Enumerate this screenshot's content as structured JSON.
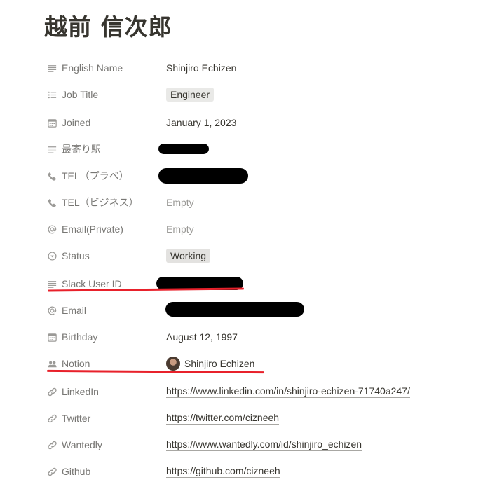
{
  "page": {
    "title": "越前 信次郎"
  },
  "properties": [
    {
      "name": "English Name",
      "icon": "text-lines-icon",
      "value": "Shinjiro Echizen"
    },
    {
      "name": "Job Title",
      "icon": "list-icon",
      "value": "Engineer"
    },
    {
      "name": "Joined",
      "icon": "calendar-icon",
      "value": "January 1, 2023"
    },
    {
      "name": "最寄り駅",
      "icon": "text-lines-icon",
      "value": ""
    },
    {
      "name": "TEL（プラベ）",
      "icon": "phone-icon",
      "value": ""
    },
    {
      "name": "TEL（ビジネス）",
      "icon": "phone-icon",
      "value": "Empty"
    },
    {
      "name": "Email(Private)",
      "icon": "at-sign-icon",
      "value": "Empty"
    },
    {
      "name": "Status",
      "icon": "status-circle-icon",
      "value": "Working"
    },
    {
      "name": "Slack User ID",
      "icon": "text-lines-icon",
      "value": ""
    },
    {
      "name": "Email",
      "icon": "at-sign-icon",
      "value": ""
    },
    {
      "name": "Birthday",
      "icon": "calendar-icon",
      "value": "August 12, 1997"
    },
    {
      "name": "Notion",
      "icon": "people-icon",
      "value": "Shinjiro Echizen"
    },
    {
      "name": "LinkedIn",
      "icon": "link-icon",
      "value": "https://www.linkedin.com/in/shinjiro-echizen-71740a247/"
    },
    {
      "name": "Twitter",
      "icon": "link-icon",
      "value": "https://twitter.com/cizneeh"
    },
    {
      "name": "Wantedly",
      "icon": "link-icon",
      "value": "https://www.wantedly.com/id/shinjiro_echizen"
    },
    {
      "name": "Github",
      "icon": "link-icon",
      "value": "https://github.com/cizneeh"
    }
  ],
  "colors": {
    "text": "#37352f",
    "label": "#787774",
    "icon": "#9b9a97",
    "tag_bg": "#e9e9e7",
    "redact": "#000000",
    "annotation_red": "#e8212b"
  }
}
